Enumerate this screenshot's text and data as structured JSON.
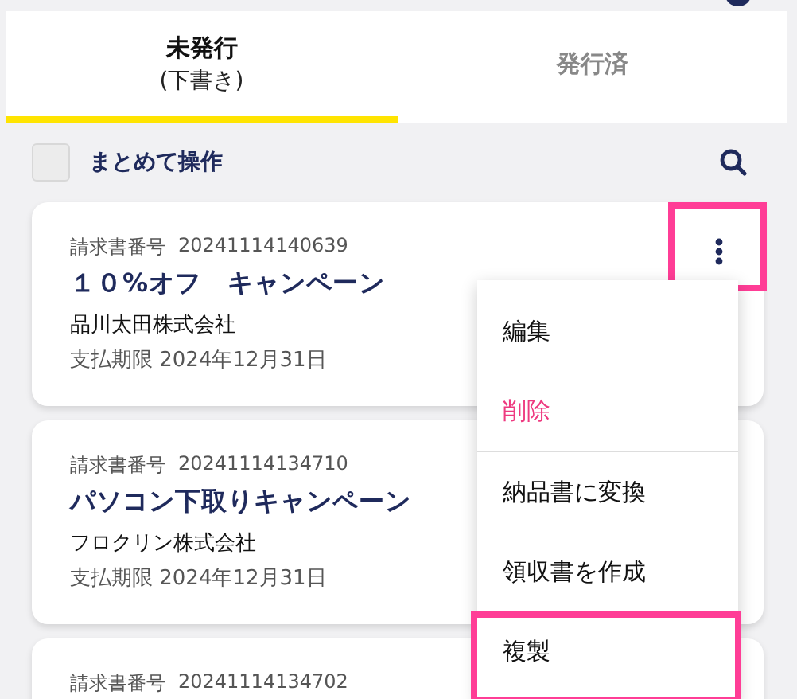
{
  "tabs": [
    {
      "label": "未発行",
      "sublabel": "(下書き)",
      "selected": true
    },
    {
      "label": "発行済",
      "selected": false
    }
  ],
  "bulk_action": {
    "label": "まとめて操作",
    "checked": false
  },
  "invoices": [
    {
      "number_label": "請求書番号",
      "number": "20241114140639",
      "title": "１０%オフ　キャンペーン",
      "client": "品川太田株式会社",
      "due": "支払期限 2024年12月31日",
      "menu_button": {
        "highlighted": true
      }
    },
    {
      "number_label": "請求書番号",
      "number": "20241114134710",
      "title": "パソコン下取りキャンペーン",
      "client": "フロクリン株式会社",
      "due": "支払期限 2024年12月31日"
    },
    {
      "number_label": "請求書番号",
      "number": "20241114134702"
    }
  ],
  "context_menu": {
    "items": [
      {
        "label": "編集",
        "kind": "normal",
        "divider_after": false,
        "highlighted": false
      },
      {
        "label": "削除",
        "kind": "danger",
        "divider_after": true,
        "highlighted": false
      },
      {
        "label": "納品書に変換",
        "kind": "normal",
        "divider_after": false,
        "highlighted": false
      },
      {
        "label": "領収書を作成",
        "kind": "normal",
        "divider_after": false,
        "highlighted": false
      },
      {
        "label": "複製",
        "kind": "normal",
        "divider_after": false,
        "highlighted": true
      }
    ]
  }
}
